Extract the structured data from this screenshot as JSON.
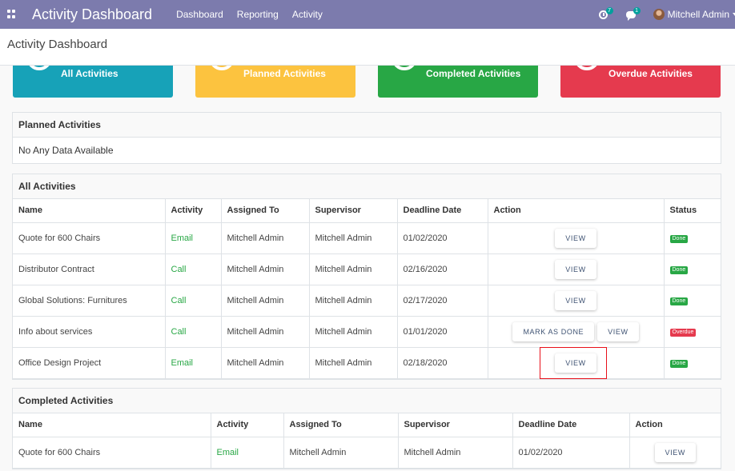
{
  "navbar": {
    "brand": "Activity Dashboard",
    "menu": [
      "Dashboard",
      "Reporting",
      "Activity"
    ],
    "activity_count": "7",
    "message_count": "1",
    "user_name": "Mitchell Admin"
  },
  "breadcrumb": "Activity Dashboard",
  "cards": {
    "all": "All Activities",
    "planned": "Planned Activities",
    "completed": "Completed Activities",
    "overdue": "Overdue Activities"
  },
  "planned_panel": {
    "title": "Planned Activities",
    "empty_message": "No Any Data Available"
  },
  "all_panel": {
    "title": "All Activities",
    "columns": [
      "Name",
      "Activity",
      "Assigned To",
      "Supervisor",
      "Deadline Date",
      "Action",
      "Status"
    ],
    "rows": [
      {
        "name": "Quote for 600 Chairs",
        "activity": "Email",
        "assigned": "Mitchell Admin",
        "supervisor": "Mitchell Admin",
        "deadline": "01/02/2020",
        "status": "Done"
      },
      {
        "name": "Distributor Contract",
        "activity": "Call",
        "assigned": "Mitchell Admin",
        "supervisor": "Mitchell Admin",
        "deadline": "02/16/2020",
        "status": "Done"
      },
      {
        "name": "Global Solutions: Furnitures",
        "activity": "Call",
        "assigned": "Mitchell Admin",
        "supervisor": "Mitchell Admin",
        "deadline": "02/17/2020",
        "status": "Done"
      },
      {
        "name": "Info about services",
        "activity": "Call",
        "assigned": "Mitchell Admin",
        "supervisor": "Mitchell Admin",
        "deadline": "01/01/2020",
        "status": "Overdue"
      },
      {
        "name": "Office Design Project",
        "activity": "Email",
        "assigned": "Mitchell Admin",
        "supervisor": "Mitchell Admin",
        "deadline": "02/18/2020",
        "status": "Done"
      }
    ],
    "view_label": "VIEW",
    "mark_done_label": "MARK AS DONE"
  },
  "completed_panel": {
    "title": "Completed Activities",
    "columns": [
      "Name",
      "Activity",
      "Assigned To",
      "Supervisor",
      "Deadline Date",
      "Action"
    ],
    "rows": [
      {
        "name": "Quote for 600 Chairs",
        "activity": "Email",
        "assigned": "Mitchell Admin",
        "supervisor": "Mitchell Admin",
        "deadline": "01/02/2020"
      }
    ],
    "view_label": "VIEW"
  },
  "colors": {
    "navbar": "#7c7bad",
    "all": "#17a2b8",
    "planned": "#fcc33f",
    "completed": "#28a745",
    "overdue": "#e53a4e"
  }
}
